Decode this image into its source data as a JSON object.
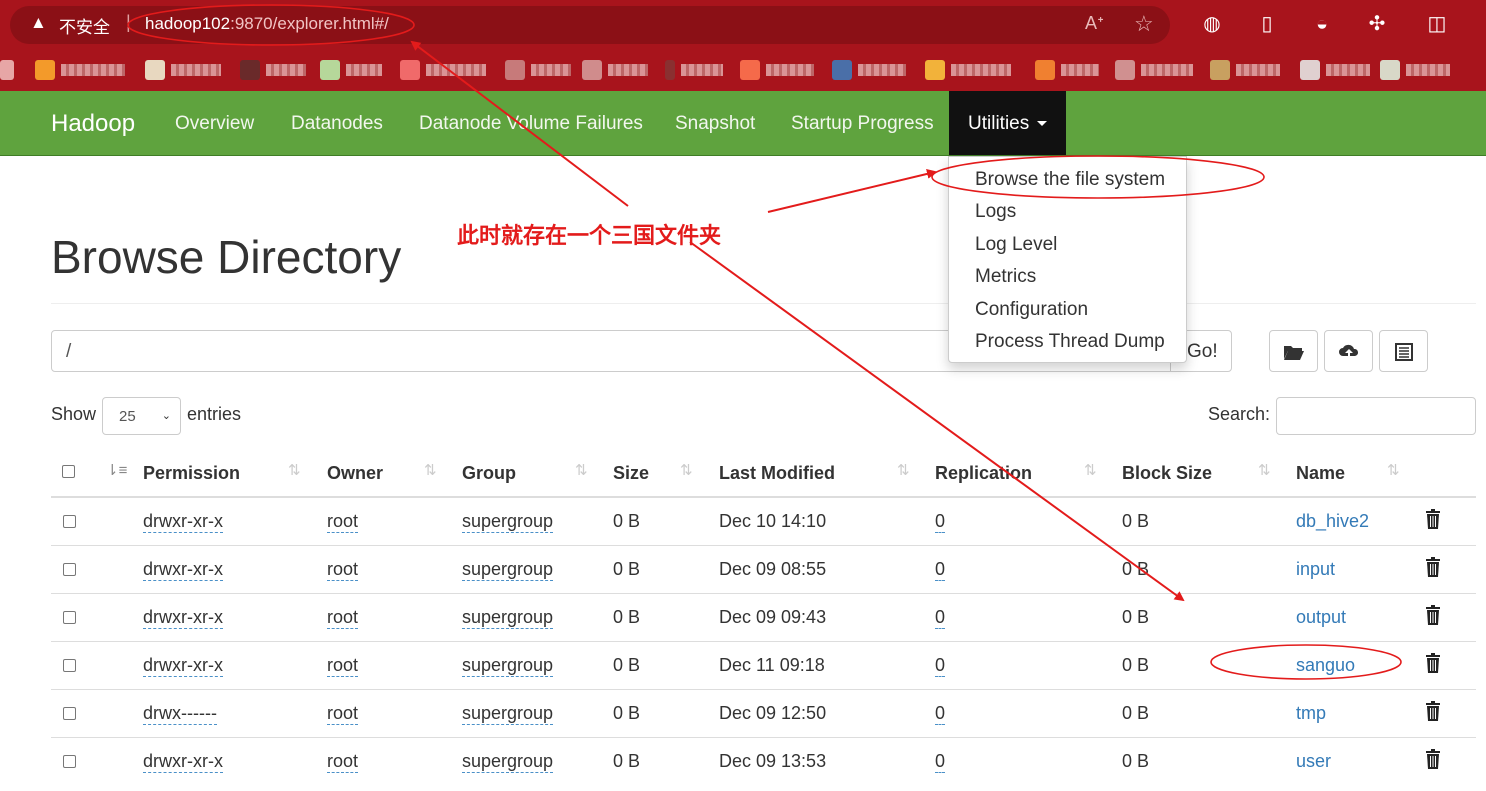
{
  "browser": {
    "security_label": "不安全",
    "url_host": "hadoop102",
    "url_rest": ":9870/explorer.html#/"
  },
  "navbar": {
    "brand": "Hadoop",
    "links": [
      "Overview",
      "Datanodes",
      "Datanode Volume Failures",
      "Snapshot",
      "Startup Progress"
    ],
    "active": "Utilities"
  },
  "dropdown": {
    "items": [
      "Browse the file system",
      "Logs",
      "Log Level",
      "Metrics",
      "Configuration",
      "Process Thread Dump"
    ]
  },
  "page": {
    "title": "Browse Directory",
    "path_value": "/",
    "go_label": "Go!",
    "show_label": "Show",
    "page_size": "25",
    "entries_label": "entries",
    "search_label": "Search:"
  },
  "table": {
    "headers": [
      "Permission",
      "Owner",
      "Group",
      "Size",
      "Last Modified",
      "Replication",
      "Block Size",
      "Name"
    ],
    "rows": [
      {
        "permission": "drwxr-xr-x",
        "owner": "root",
        "group": "supergroup",
        "size": "0 B",
        "modified": "Dec 10 14:10",
        "replication": "0",
        "block_size": "0 B",
        "name": "db_hive2"
      },
      {
        "permission": "drwxr-xr-x",
        "owner": "root",
        "group": "supergroup",
        "size": "0 B",
        "modified": "Dec 09 08:55",
        "replication": "0",
        "block_size": "0 B",
        "name": "input"
      },
      {
        "permission": "drwxr-xr-x",
        "owner": "root",
        "group": "supergroup",
        "size": "0 B",
        "modified": "Dec 09 09:43",
        "replication": "0",
        "block_size": "0 B",
        "name": "output"
      },
      {
        "permission": "drwxr-xr-x",
        "owner": "root",
        "group": "supergroup",
        "size": "0 B",
        "modified": "Dec 11 09:18",
        "replication": "0",
        "block_size": "0 B",
        "name": "sanguo"
      },
      {
        "permission": "drwx------",
        "owner": "root",
        "group": "supergroup",
        "size": "0 B",
        "modified": "Dec 09 12:50",
        "replication": "0",
        "block_size": "0 B",
        "name": "tmp"
      },
      {
        "permission": "drwxr-xr-x",
        "owner": "root",
        "group": "supergroup",
        "size": "0 B",
        "modified": "Dec 09 13:53",
        "replication": "0",
        "block_size": "0 B",
        "name": "user"
      }
    ]
  },
  "annotation": {
    "text": "此时就存在一个三国文件夹",
    "color": "#e31b1b"
  },
  "icons": [
    "warning-icon",
    "read-aloud-icon",
    "favorite-star-icon",
    "folder-open-icon",
    "upload-cloud-icon",
    "list-icon",
    "trash-icon",
    "sort-icon"
  ],
  "colors": {
    "navbar": "#5fa33e",
    "browser": "#a8141c",
    "link": "#337ab7"
  }
}
